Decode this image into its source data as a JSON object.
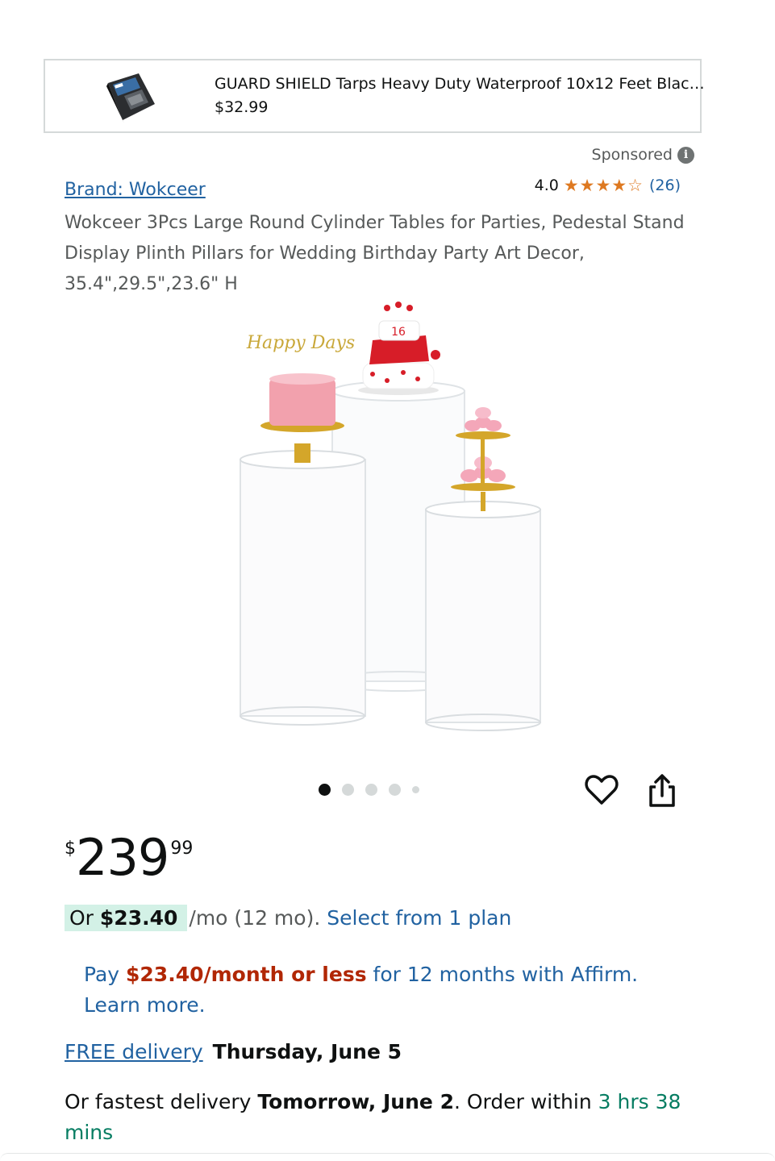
{
  "sponsored_ad": {
    "title": "GUARD SHIELD Tarps Heavy Duty Waterproof 10x12 Feet Blac…",
    "price": "$32.99",
    "thumbnail_icon": "tarp-package-icon"
  },
  "sponsored_label": "Sponsored",
  "brand": "Brand: Wokceer",
  "rating": {
    "value": "4.0",
    "stars": 4,
    "max": 5,
    "count": "(26)"
  },
  "product_title": "Wokceer 3Pcs Large Round Cylinder Tables for Parties, Pedestal Stand Display Plinth Pillars for Wedding Birthday Party Art Decor, 35.4\",29.5\",23.6\" H",
  "image": {
    "cake_topper_text": "Happy Days",
    "cake_number": "16",
    "carousel_total": 5,
    "carousel_active": 1
  },
  "price": {
    "symbol": "$",
    "whole": "239",
    "fraction": "99"
  },
  "monthly": {
    "prefix": "Or ",
    "amount": "$23.40",
    "rest": "/mo (12 mo).",
    "link": "Select from 1 plan"
  },
  "affirm": {
    "pay": "Pay ",
    "amount": "$23.40/month or less",
    "rest": " for 12 months with Affirm. Learn more."
  },
  "delivery": {
    "free_label": "FREE delivery",
    "free_date": "Thursday, June 5",
    "fastest_prefix": "Or fastest delivery ",
    "fastest_date": "Tomorrow, June 2",
    "order_within": ". Order within ",
    "countdown": "3 hrs 38 mins"
  },
  "colors": {
    "link": "#2162a1",
    "star": "#de7921",
    "deal_red": "#b12704",
    "countdown_green": "#067d62",
    "badge_bg": "#d3f1e6"
  }
}
